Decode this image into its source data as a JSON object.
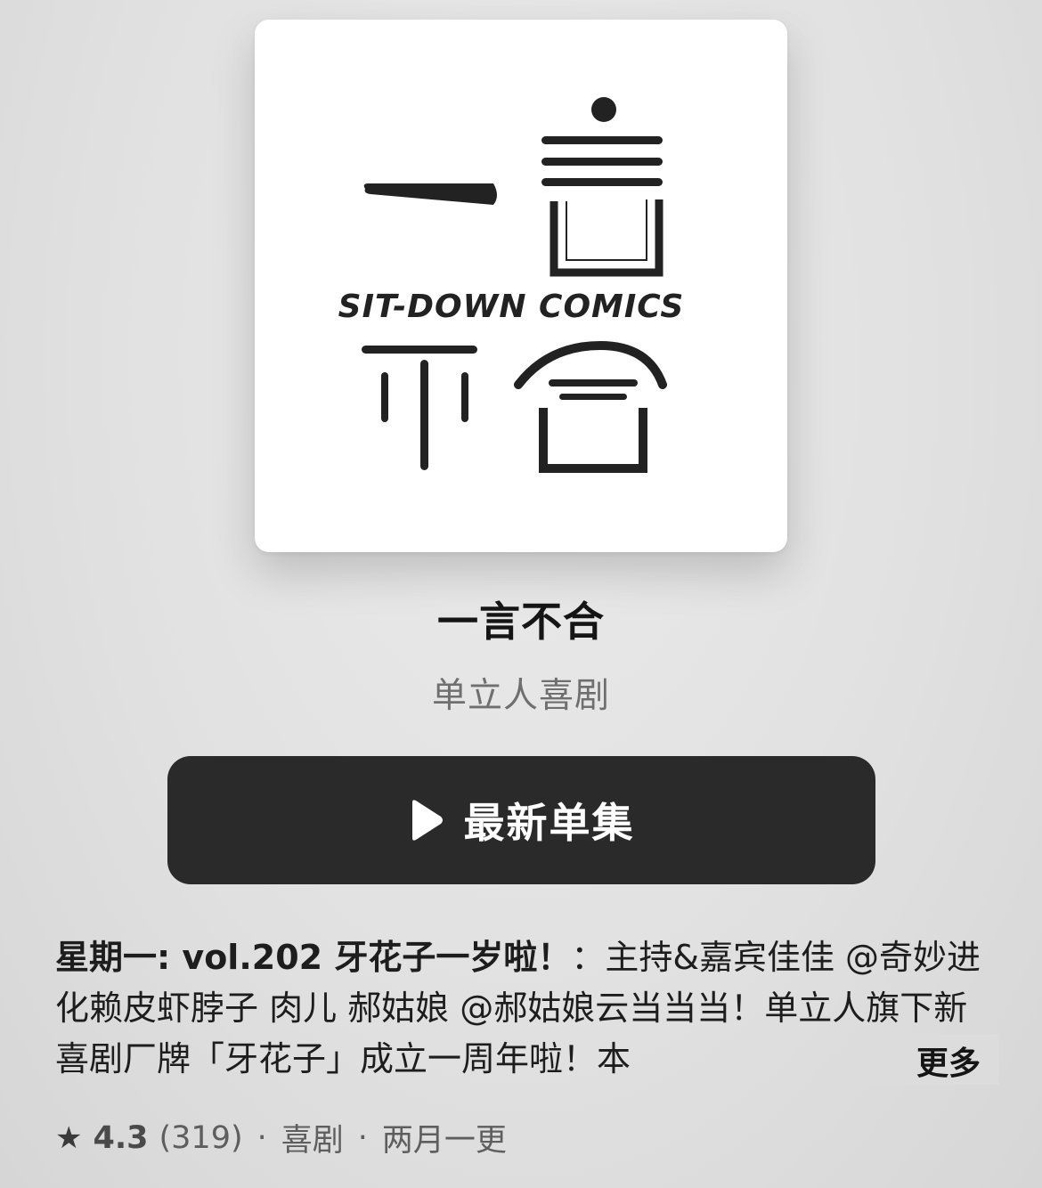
{
  "podcast": {
    "logo_text": "SIT-DOWN COMICS",
    "title": "一言不合",
    "author": "单立人喜剧"
  },
  "actions": {
    "play_icon": "play-icon",
    "play_label": "最新单集"
  },
  "description": {
    "episode_title": "星期一: vol.202 牙花子一岁啦！",
    "text": "：主持&嘉宾佳佳 @奇妙进化赖皮虾脖子 肉儿 郝姑娘 @郝姑娘云当当当！单立人旗下新喜剧厂牌「牙花子」成立一周年啦！本",
    "more_label": "更多"
  },
  "meta": {
    "star_icon": "star-icon",
    "rating": "4.3",
    "rating_count": "(319)",
    "separator": "·",
    "genre": "喜剧",
    "frequency": "两月一更"
  }
}
